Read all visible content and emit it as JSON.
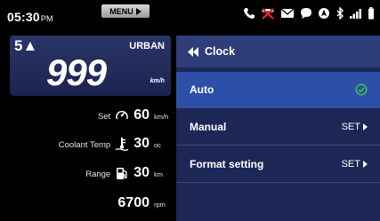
{
  "status": {
    "time": "05:30",
    "ampm": "PM",
    "menu_label": "MENU",
    "icons": [
      "phone-icon",
      "muted-icon",
      "mail-icon",
      "chat-icon",
      "navigation-icon",
      "bluetooth-icon",
      "signal-icon",
      "battery-icon"
    ],
    "accent": "#e8202a"
  },
  "cluster": {
    "gear": "5▲",
    "mode": "URBAN",
    "speed": "999",
    "speed_unit": "km/h",
    "set_label": "Set",
    "set_value": "60",
    "set_unit": "km/h",
    "coolant_label": "Coolant Temp",
    "coolant_value": "30",
    "coolant_unit": "oc",
    "range_label": "Range",
    "range_value": "30",
    "range_unit": "km",
    "rpm_value": "6700",
    "rpm_unit": "rpm"
  },
  "menu": {
    "title": "Clock",
    "items": [
      {
        "label": "Auto",
        "right": ""
      },
      {
        "label": "Manual",
        "right": "SET"
      },
      {
        "label": "Format setting",
        "right": "SET"
      }
    ],
    "selected_check_color": "#3ed33e"
  }
}
